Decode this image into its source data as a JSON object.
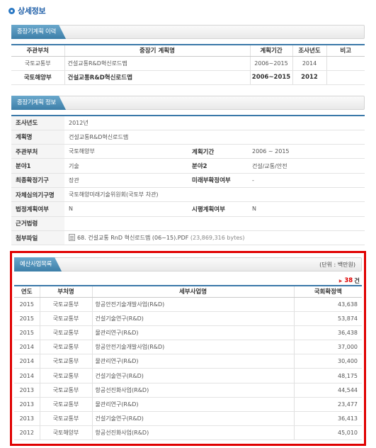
{
  "page_title": "상세정보",
  "history": {
    "section_title": "중장기계획 이력",
    "columns": [
      "주관부처",
      "중장기 계획명",
      "계획기간",
      "조사년도",
      "비고"
    ],
    "rows": [
      {
        "dept": "국토교통부",
        "name": "건설교통R&D혁신로드맵",
        "period": "2006~2015",
        "year": "2014",
        "note": ""
      },
      {
        "dept": "국토해양부",
        "name": "건설교통R&D혁신로드맵",
        "period": "2006~2015",
        "year": "2012",
        "note": ""
      }
    ]
  },
  "info": {
    "section_title": "중장기계획 정보",
    "survey_year_label": "조사년도",
    "survey_year": "2012년",
    "plan_name_label": "계획명",
    "plan_name": "건설교통R&D혁신로드맵",
    "dept_label": "주관부처",
    "dept": "국토해양부",
    "period_label": "계획기간",
    "period": "2006 ~ 2015",
    "field1_label": "분야1",
    "field1": "기술",
    "field2_label": "분야2",
    "field2": "건설/교통/안전",
    "final_agency_label": "최종확정기구",
    "final_agency": "장관",
    "future_label": "미래부확정여부",
    "future": "-",
    "review_label": "자체심의기구명",
    "review": "국토해양미래기술위원회(국토부 차관)",
    "legal_label": "법정계획여부",
    "legal": "N",
    "impl_label": "시행계획여부",
    "impl": "N",
    "law_label": "근거법령",
    "law": "",
    "attach_label": "첨부파일",
    "attach_name": "68. 건설교통 RnD 혁신로드맵 (06~15).PDF",
    "attach_size": "(23,869,316 bytes)"
  },
  "budget": {
    "section_title": "예산사업목록",
    "unit": "(단위 : 백만원)",
    "count": "38",
    "count_unit": "건",
    "columns": [
      "연도",
      "부처명",
      "세부사업명",
      "국회확정액"
    ],
    "rows": [
      {
        "year": "2015",
        "dept": "국토교통부",
        "project": "항공안전기술개발사업(R&D)",
        "amount": "43,638"
      },
      {
        "year": "2015",
        "dept": "국토교통부",
        "project": "건설기술연구(R&D)",
        "amount": "53,874"
      },
      {
        "year": "2015",
        "dept": "국토교통부",
        "project": "물관리연구(R&D)",
        "amount": "36,438"
      },
      {
        "year": "2014",
        "dept": "국토교통부",
        "project": "항공안전기술개발사업(R&D)",
        "amount": "37,000"
      },
      {
        "year": "2014",
        "dept": "국토교통부",
        "project": "물관리연구(R&D)",
        "amount": "30,400"
      },
      {
        "year": "2014",
        "dept": "국토교통부",
        "project": "건설기술연구(R&D)",
        "amount": "48,175"
      },
      {
        "year": "2013",
        "dept": "국토교통부",
        "project": "항공선진화사업(R&D)",
        "amount": "44,544"
      },
      {
        "year": "2013",
        "dept": "국토교통부",
        "project": "물관리연구(R&D)",
        "amount": "23,477"
      },
      {
        "year": "2013",
        "dept": "국토교통부",
        "project": "건설기술연구(R&D)",
        "amount": "36,413"
      },
      {
        "year": "2012",
        "dept": "국토해양부",
        "project": "항공선진화사업(R&D)",
        "amount": "45,010"
      }
    ]
  }
}
